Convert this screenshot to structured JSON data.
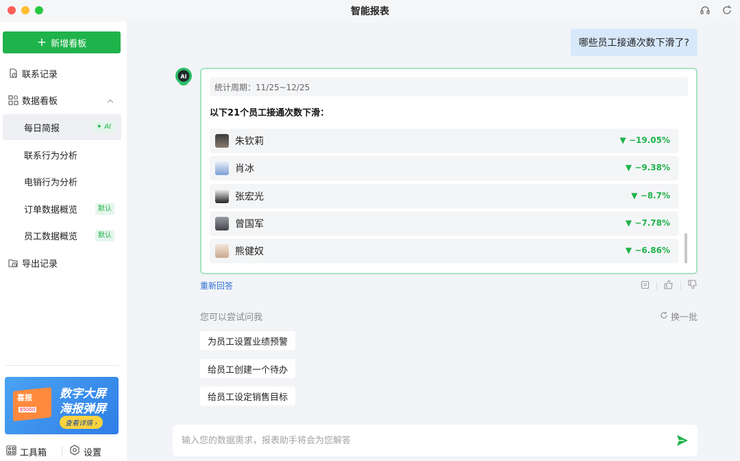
{
  "window": {
    "title": "智能报表"
  },
  "colors": {
    "accent": "#1fb34b",
    "decline": "#1fb34b",
    "user_bubble": "#d7e8fb",
    "card_border": "#a6e3bf"
  },
  "sidebar": {
    "new_board_label": "新增看板",
    "contact_records": "联系记录",
    "dashboards": "数据看板",
    "sub_items": [
      {
        "label": "每日简报",
        "badge": "AI",
        "active": true
      },
      {
        "label": "联系行为分析",
        "badge": ""
      },
      {
        "label": "电销行为分析",
        "badge": ""
      },
      {
        "label": "订单数据概览",
        "badge": "默认"
      },
      {
        "label": "员工数据概览",
        "badge": "默认"
      }
    ],
    "export_records": "导出记录",
    "promo": {
      "line1": "数字大屏",
      "line2": "海报弹屏",
      "button": "查看详情",
      "board_title": "喜报",
      "board_number": "65000"
    },
    "toolbox": "工具箱",
    "settings": "设置"
  },
  "chat": {
    "user_question": "哪些员工接通次数下滑了?",
    "period": "统计周期：11/25~12/25",
    "answer_headline": "以下21个员工接通次数下滑：",
    "rows": [
      {
        "name": "朱钦莉",
        "change": "▼ −19.05%"
      },
      {
        "name": "肖冰",
        "change": "▼ −9.38%"
      },
      {
        "name": "张宏光",
        "change": "▼ −8.7%"
      },
      {
        "name": "曾国军",
        "change": "▼ −7.78%"
      },
      {
        "name": "熊健奴",
        "change": "▼ −6.86%"
      }
    ],
    "retry_label": "重新回答",
    "suggest_title": "您可以尝试问我",
    "refresh_label": "换一批",
    "suggestions": [
      "为员工设置业绩预警",
      "给员工创建一个待办",
      "给员工设定销售目标"
    ],
    "input_placeholder": "输入您的数据需求，报表助手将会为您解答"
  }
}
